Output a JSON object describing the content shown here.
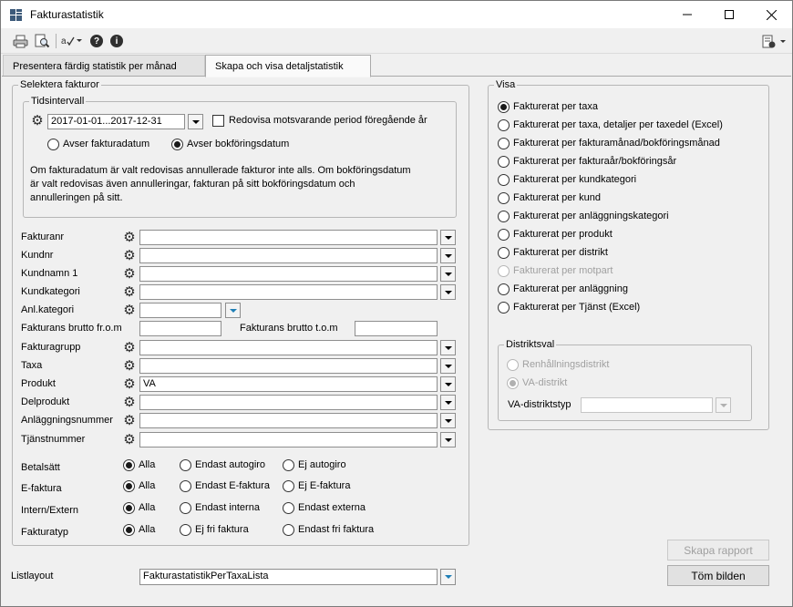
{
  "window": {
    "title": "Fakturastatistik"
  },
  "tabs": [
    {
      "label": "Presentera färdig statistik per månad"
    },
    {
      "label": "Skapa och visa detaljstatistik"
    }
  ],
  "selection": {
    "legend": "Selektera fakturor",
    "interval": {
      "legend": "Tidsintervall",
      "date_range": "2017-01-01...2017-12-31",
      "prev_period_label": "Redovisa motsvarande period föregående år",
      "radio_invoice_date": "Avser fakturadatum",
      "radio_booking_date": "Avser bokföringsdatum",
      "note_line1": "Om fakturadatum är valt redovisas annullerade fakturor inte alls. Om bokföringsdatum",
      "note_line2": "är valt redovisas även annulleringar, fakturan på sitt bokföringsdatum och",
      "note_line3": "annulleringen på sitt."
    },
    "fields": {
      "fakturanr": {
        "label": "Fakturanr",
        "value": ""
      },
      "kundnr": {
        "label": "Kundnr",
        "value": ""
      },
      "kundnamn": {
        "label": "Kundnamn 1",
        "value": ""
      },
      "kundkategori": {
        "label": "Kundkategori",
        "value": ""
      },
      "anlkategori": {
        "label": "Anl.kategori",
        "value": ""
      },
      "brutto_from": {
        "label": "Fakturans brutto fr.o.m",
        "value": ""
      },
      "brutto_tom": {
        "label": "Fakturans brutto t.o.m",
        "value": ""
      },
      "fakturagrupp": {
        "label": "Fakturagrupp",
        "value": ""
      },
      "taxa": {
        "label": "Taxa",
        "value": ""
      },
      "produkt": {
        "label": "Produkt",
        "value": "VA"
      },
      "delprodukt": {
        "label": "Delprodukt",
        "value": ""
      },
      "anlaggningsnummer": {
        "label": "Anläggningsnummer",
        "value": ""
      },
      "tjanstnummer": {
        "label": "Tjänstnummer",
        "value": ""
      }
    },
    "radio_groups": {
      "betalsatt": {
        "label": "Betalsätt",
        "opt1": "Alla",
        "opt2": "Endast autogiro",
        "opt3": "Ej autogiro"
      },
      "efaktura": {
        "label": "E-faktura",
        "opt1": "Alla",
        "opt2": "Endast E-faktura",
        "opt3": "Ej E-faktura"
      },
      "intern": {
        "label": "Intern/Extern",
        "opt1": "Alla",
        "opt2": "Endast interna",
        "opt3": "Endast externa"
      },
      "fakturatyp": {
        "label": "Fakturatyp",
        "opt1": "Alla",
        "opt2": "Ej fri faktura",
        "opt3": "Endast fri faktura"
      }
    }
  },
  "visa": {
    "legend": "Visa",
    "options": [
      {
        "label": "Fakturerat per taxa"
      },
      {
        "label": "Fakturerat per taxa, detaljer per taxedel (Excel)"
      },
      {
        "label": "Fakturerat per fakturamånad/bokföringsmånad"
      },
      {
        "label": "Fakturerat per  fakturaår/bokföringsår"
      },
      {
        "label": "Fakturerat per kundkategori"
      },
      {
        "label": "Fakturerat per kund"
      },
      {
        "label": "Fakturerat per anläggningskategori"
      },
      {
        "label": "Fakturerat per produkt"
      },
      {
        "label": "Fakturerat per distrikt"
      },
      {
        "label": "Fakturerat per motpart"
      },
      {
        "label": "Fakturerat per anläggning"
      },
      {
        "label": "Fakturerat per Tjänst (Excel)"
      }
    ],
    "district": {
      "legend": "Distriktsval",
      "opt_renhallning": "Renhållningsdistrikt",
      "opt_va": "VA-distrikt",
      "type_label": "VA-distriktstyp",
      "type_value": ""
    }
  },
  "listlayout": {
    "label": "Listlayout",
    "value": "FakturastatistikPerTaxaLista"
  },
  "buttons": {
    "create_report": "Skapa rapport",
    "clear": "Töm bilden"
  }
}
